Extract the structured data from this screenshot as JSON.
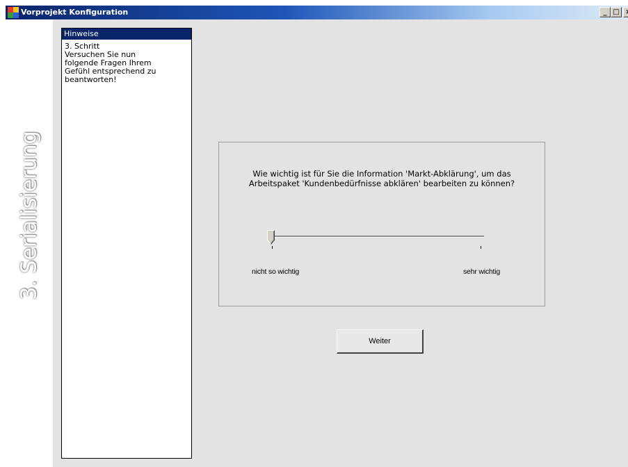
{
  "window": {
    "title": "Vorprojekt Konfiguration",
    "controls": {
      "minimize": "_",
      "maximize": "□",
      "close": "×"
    }
  },
  "side_label": "3. Serialisierung",
  "hints": {
    "header": "Hinweise",
    "lines": [
      "3. Schritt",
      "Versuchen Sie nun",
      "folgende Fragen Ihrem",
      "Gefühl entsprechend zu",
      "beantworten!"
    ]
  },
  "question": {
    "line1": "Wie wichtig ist für Sie die Information 'Markt-Abklärung', um das",
    "line2": "Arbeitspaket 'Kundenbedürfnisse abklären' bearbeiten zu können?",
    "slider": {
      "min_label": "nicht so wichtig",
      "max_label": "sehr wichtig",
      "value": 0
    }
  },
  "buttons": {
    "next": "Weiter"
  },
  "colors": {
    "titlebar_start": "#0a246a",
    "hint_header": "#0a246a",
    "background": "#e3e3e3"
  }
}
